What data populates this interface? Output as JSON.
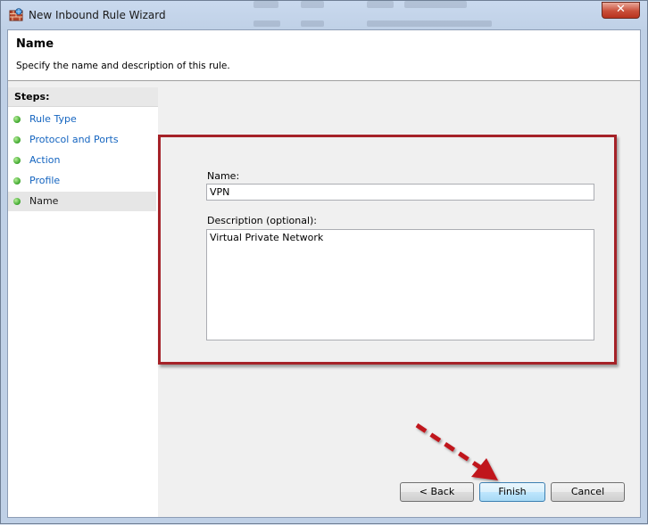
{
  "window": {
    "title": "New Inbound Rule Wizard",
    "close_label": "✕"
  },
  "header": {
    "title": "Name",
    "subtitle": "Specify the name and description of this rule."
  },
  "steps": {
    "title": "Steps:",
    "items": [
      {
        "label": "Rule Type",
        "active": false
      },
      {
        "label": "Protocol and Ports",
        "active": false
      },
      {
        "label": "Action",
        "active": false
      },
      {
        "label": "Profile",
        "active": false
      },
      {
        "label": "Name",
        "active": true
      }
    ]
  },
  "form": {
    "name_label": "Name:",
    "name_value": "VPN",
    "description_label": "Description (optional):",
    "description_value": "Virtual Private Network"
  },
  "buttons": {
    "back": "< Back",
    "finish": "Finish",
    "cancel": "Cancel"
  },
  "colors": {
    "highlight_border": "#a52228",
    "step_link": "#1565c0",
    "annotation_arrow": "#c0141c"
  },
  "icons": {
    "app": "firewall-icon",
    "close": "close-icon",
    "step_bullet": "green-dot-icon"
  }
}
